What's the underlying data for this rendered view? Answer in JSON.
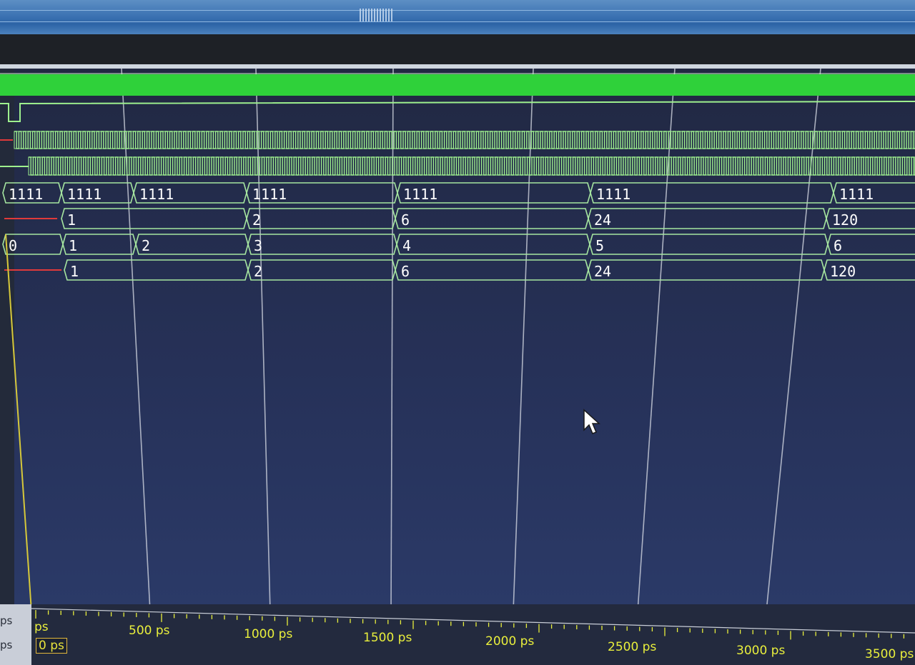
{
  "colors": {
    "wave": "#9ef08e",
    "bus_outline": "#a6e6a0",
    "high_bar": "#2fd13a",
    "undefined": "#e03a3a",
    "cursor": "#d6c83a",
    "grid": "#d9dde6",
    "time_labels": "#e9ef3c"
  },
  "signals": {
    "row1_values": [
      "1111",
      "1111",
      "1111",
      "1111",
      "1111",
      "1111",
      "1111"
    ],
    "row2_values": [
      "1",
      "2",
      "6",
      "24",
      "120"
    ],
    "row3_values": [
      "0",
      "1",
      "2",
      "3",
      "4",
      "5",
      "6"
    ],
    "row4_values": [
      "1",
      "2",
      "6",
      "24",
      "120"
    ]
  },
  "timebar": {
    "side_units": [
      "ps",
      "ps"
    ],
    "cursor_time": "0 ps",
    "start_label": "ps",
    "labels": [
      "500 ps",
      "1000 ps",
      "1500 ps",
      "2000 ps",
      "2500 ps",
      "3000 ps",
      "3500 ps"
    ]
  },
  "icons": {
    "pointer": "mouse-pointer-icon",
    "grip": "splitter-grip-icon"
  }
}
